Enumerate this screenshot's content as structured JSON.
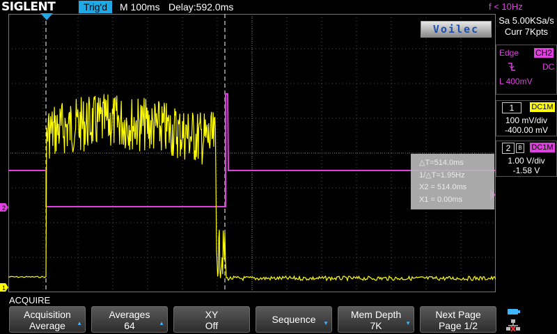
{
  "top_bar": {
    "brand": "SIGLENT",
    "trigger_status": "Trig'd",
    "timebase": "M 100ms",
    "delay": "Delay:592.0ms",
    "frequency": "f < 10Hz"
  },
  "acquisition_info": {
    "sample_rate": "Sa 5.00KSa/s",
    "memory": "Curr 7Kpts"
  },
  "watermark": "Voilec",
  "trigger_box": {
    "type": "Edge",
    "source": "CH2",
    "slope_icon": "falling-edge-icon",
    "coupling": "DC",
    "level": "L  400mV"
  },
  "channels": [
    {
      "number": "1",
      "coupling": "DC1M",
      "scale": "100 mV/div",
      "offset": "-400.00 mV",
      "color": "#ffff00"
    },
    {
      "number": "2",
      "coupling": "DC1M",
      "scale": "1.00 V/div",
      "offset": "-1.58 V",
      "color": "#e040e0"
    }
  ],
  "cursor_readout": {
    "delta_t": "△T=514.0ms",
    "inverse_delta_t": "1/△T=1.95Hz",
    "x2": "X2 = 514.0ms",
    "x1": "X1 = 0.00ms"
  },
  "menu": {
    "title": "ACQUIRE",
    "softkeys": [
      {
        "line1": "Acquisition",
        "line2": "Average",
        "arrow": "▲"
      },
      {
        "line1": "Averages",
        "line2": "64",
        "arrow": "▲"
      },
      {
        "line1": "XY",
        "line2": "Off",
        "arrow": ""
      },
      {
        "line1": "Sequence",
        "line2": "",
        "arrow": "▼"
      },
      {
        "line1": "Mem Depth",
        "line2": "7K",
        "arrow": "▼"
      },
      {
        "line1": "Next Page",
        "line2": "Page 1/2",
        "arrow": ""
      }
    ]
  },
  "colors": {
    "ch1": "#ffff00",
    "ch2": "#e040e0",
    "trigger_marker": "#1fa9e6",
    "grid": "#5a5a5a"
  }
}
